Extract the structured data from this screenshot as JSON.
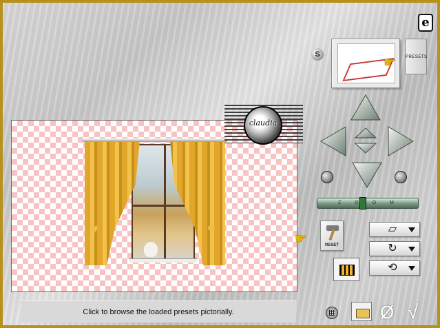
{
  "status_bar": {
    "text": "Click to browse the loaded presets pictorially."
  },
  "presets": {
    "label": "PRESETS",
    "s_badge": "S"
  },
  "reset": {
    "label": "RESET"
  },
  "zoom": {
    "label": "Z O O M",
    "level": 0.45
  },
  "watermark": {
    "text": "claudia"
  },
  "logo": {
    "glyph": "e"
  },
  "tools": [
    {
      "name": "perspective-grid",
      "glyph": "▱"
    },
    {
      "name": "rotate-loop",
      "glyph": "↻"
    },
    {
      "name": "flip-loop",
      "glyph": "⟲"
    }
  ],
  "colors": {
    "frame": "#b8901c",
    "checker_pink": "#f7c3c3",
    "curtain": "#e2a62a",
    "zoom_green": "#7e9b86"
  }
}
